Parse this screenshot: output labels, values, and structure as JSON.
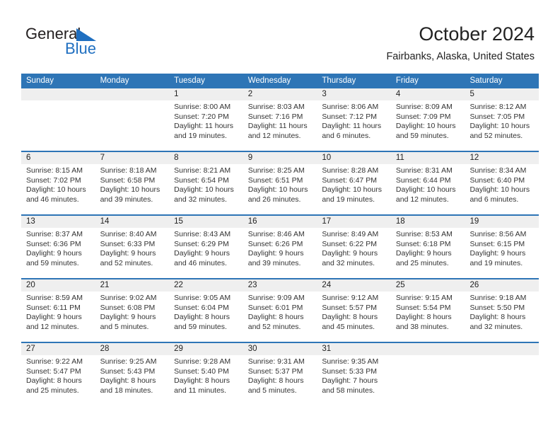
{
  "brand": {
    "name_part1": "General",
    "name_part2": "Blue",
    "triangle_icon": "triangle-logo-icon",
    "accent_color": "#1f6fc0"
  },
  "header": {
    "title": "October 2024",
    "subtitle": "Fairbanks, Alaska, United States"
  },
  "theme": {
    "header_blue": "#2e75b6",
    "day_band_gray": "#efefef",
    "text_color": "#222222"
  },
  "weekdays": [
    "Sunday",
    "Monday",
    "Tuesday",
    "Wednesday",
    "Thursday",
    "Friday",
    "Saturday"
  ],
  "weeks": [
    [
      {
        "day": "",
        "lines": []
      },
      {
        "day": "",
        "lines": []
      },
      {
        "day": "1",
        "lines": [
          "Sunrise: 8:00 AM",
          "Sunset: 7:20 PM",
          "Daylight: 11 hours",
          "and 19 minutes."
        ]
      },
      {
        "day": "2",
        "lines": [
          "Sunrise: 8:03 AM",
          "Sunset: 7:16 PM",
          "Daylight: 11 hours",
          "and 12 minutes."
        ]
      },
      {
        "day": "3",
        "lines": [
          "Sunrise: 8:06 AM",
          "Sunset: 7:12 PM",
          "Daylight: 11 hours",
          "and 6 minutes."
        ]
      },
      {
        "day": "4",
        "lines": [
          "Sunrise: 8:09 AM",
          "Sunset: 7:09 PM",
          "Daylight: 10 hours",
          "and 59 minutes."
        ]
      },
      {
        "day": "5",
        "lines": [
          "Sunrise: 8:12 AM",
          "Sunset: 7:05 PM",
          "Daylight: 10 hours",
          "and 52 minutes."
        ]
      }
    ],
    [
      {
        "day": "6",
        "lines": [
          "Sunrise: 8:15 AM",
          "Sunset: 7:02 PM",
          "Daylight: 10 hours",
          "and 46 minutes."
        ]
      },
      {
        "day": "7",
        "lines": [
          "Sunrise: 8:18 AM",
          "Sunset: 6:58 PM",
          "Daylight: 10 hours",
          "and 39 minutes."
        ]
      },
      {
        "day": "8",
        "lines": [
          "Sunrise: 8:21 AM",
          "Sunset: 6:54 PM",
          "Daylight: 10 hours",
          "and 32 minutes."
        ]
      },
      {
        "day": "9",
        "lines": [
          "Sunrise: 8:25 AM",
          "Sunset: 6:51 PM",
          "Daylight: 10 hours",
          "and 26 minutes."
        ]
      },
      {
        "day": "10",
        "lines": [
          "Sunrise: 8:28 AM",
          "Sunset: 6:47 PM",
          "Daylight: 10 hours",
          "and 19 minutes."
        ]
      },
      {
        "day": "11",
        "lines": [
          "Sunrise: 8:31 AM",
          "Sunset: 6:44 PM",
          "Daylight: 10 hours",
          "and 12 minutes."
        ]
      },
      {
        "day": "12",
        "lines": [
          "Sunrise: 8:34 AM",
          "Sunset: 6:40 PM",
          "Daylight: 10 hours",
          "and 6 minutes."
        ]
      }
    ],
    [
      {
        "day": "13",
        "lines": [
          "Sunrise: 8:37 AM",
          "Sunset: 6:36 PM",
          "Daylight: 9 hours",
          "and 59 minutes."
        ]
      },
      {
        "day": "14",
        "lines": [
          "Sunrise: 8:40 AM",
          "Sunset: 6:33 PM",
          "Daylight: 9 hours",
          "and 52 minutes."
        ]
      },
      {
        "day": "15",
        "lines": [
          "Sunrise: 8:43 AM",
          "Sunset: 6:29 PM",
          "Daylight: 9 hours",
          "and 46 minutes."
        ]
      },
      {
        "day": "16",
        "lines": [
          "Sunrise: 8:46 AM",
          "Sunset: 6:26 PM",
          "Daylight: 9 hours",
          "and 39 minutes."
        ]
      },
      {
        "day": "17",
        "lines": [
          "Sunrise: 8:49 AM",
          "Sunset: 6:22 PM",
          "Daylight: 9 hours",
          "and 32 minutes."
        ]
      },
      {
        "day": "18",
        "lines": [
          "Sunrise: 8:53 AM",
          "Sunset: 6:18 PM",
          "Daylight: 9 hours",
          "and 25 minutes."
        ]
      },
      {
        "day": "19",
        "lines": [
          "Sunrise: 8:56 AM",
          "Sunset: 6:15 PM",
          "Daylight: 9 hours",
          "and 19 minutes."
        ]
      }
    ],
    [
      {
        "day": "20",
        "lines": [
          "Sunrise: 8:59 AM",
          "Sunset: 6:11 PM",
          "Daylight: 9 hours",
          "and 12 minutes."
        ]
      },
      {
        "day": "21",
        "lines": [
          "Sunrise: 9:02 AM",
          "Sunset: 6:08 PM",
          "Daylight: 9 hours",
          "and 5 minutes."
        ]
      },
      {
        "day": "22",
        "lines": [
          "Sunrise: 9:05 AM",
          "Sunset: 6:04 PM",
          "Daylight: 8 hours",
          "and 59 minutes."
        ]
      },
      {
        "day": "23",
        "lines": [
          "Sunrise: 9:09 AM",
          "Sunset: 6:01 PM",
          "Daylight: 8 hours",
          "and 52 minutes."
        ]
      },
      {
        "day": "24",
        "lines": [
          "Sunrise: 9:12 AM",
          "Sunset: 5:57 PM",
          "Daylight: 8 hours",
          "and 45 minutes."
        ]
      },
      {
        "day": "25",
        "lines": [
          "Sunrise: 9:15 AM",
          "Sunset: 5:54 PM",
          "Daylight: 8 hours",
          "and 38 minutes."
        ]
      },
      {
        "day": "26",
        "lines": [
          "Sunrise: 9:18 AM",
          "Sunset: 5:50 PM",
          "Daylight: 8 hours",
          "and 32 minutes."
        ]
      }
    ],
    [
      {
        "day": "27",
        "lines": [
          "Sunrise: 9:22 AM",
          "Sunset: 5:47 PM",
          "Daylight: 8 hours",
          "and 25 minutes."
        ]
      },
      {
        "day": "28",
        "lines": [
          "Sunrise: 9:25 AM",
          "Sunset: 5:43 PM",
          "Daylight: 8 hours",
          "and 18 minutes."
        ]
      },
      {
        "day": "29",
        "lines": [
          "Sunrise: 9:28 AM",
          "Sunset: 5:40 PM",
          "Daylight: 8 hours",
          "and 11 minutes."
        ]
      },
      {
        "day": "30",
        "lines": [
          "Sunrise: 9:31 AM",
          "Sunset: 5:37 PM",
          "Daylight: 8 hours",
          "and 5 minutes."
        ]
      },
      {
        "day": "31",
        "lines": [
          "Sunrise: 9:35 AM",
          "Sunset: 5:33 PM",
          "Daylight: 7 hours",
          "and 58 minutes."
        ]
      },
      {
        "day": "",
        "lines": []
      },
      {
        "day": "",
        "lines": []
      }
    ]
  ]
}
